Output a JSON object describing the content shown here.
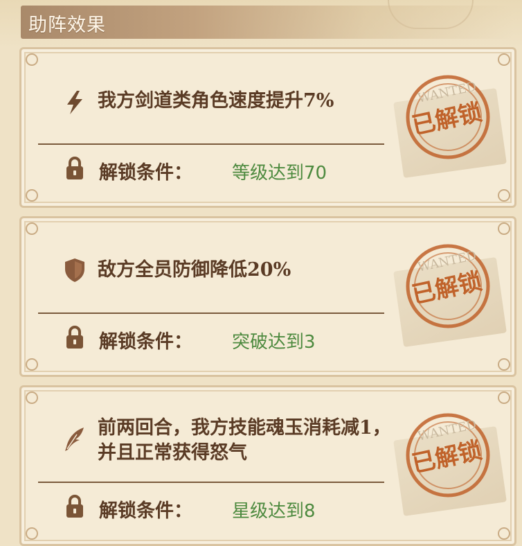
{
  "header": {
    "title": "助阵效果"
  },
  "cards": [
    {
      "icon": "lightning-icon",
      "effect": "我方剑道类角色速度提升7%",
      "effect_line2": "",
      "condition_label": "解锁条件：",
      "condition_value": "等级达到70",
      "stamp": "已解锁",
      "stamp_sub": "WANTED"
    },
    {
      "icon": "shield-icon",
      "effect": "敌方全员防御降低20%",
      "effect_line2": "",
      "condition_label": "解锁条件：",
      "condition_value": "突破达到3",
      "stamp": "已解锁",
      "stamp_sub": "WANTED"
    },
    {
      "icon": "feather-icon",
      "effect": "前两回合，我方技能魂玉消耗减1，",
      "effect_line2": "并且正常获得怒气",
      "condition_label": "解锁条件：",
      "condition_value": "星级达到8",
      "stamp": "已解锁",
      "stamp_sub": "WANTED"
    }
  ],
  "colors": {
    "effect_text": "#5a3b25",
    "condition_value": "#4d8a3f",
    "stamp": "#c0622a",
    "background": "#efe2c6"
  }
}
